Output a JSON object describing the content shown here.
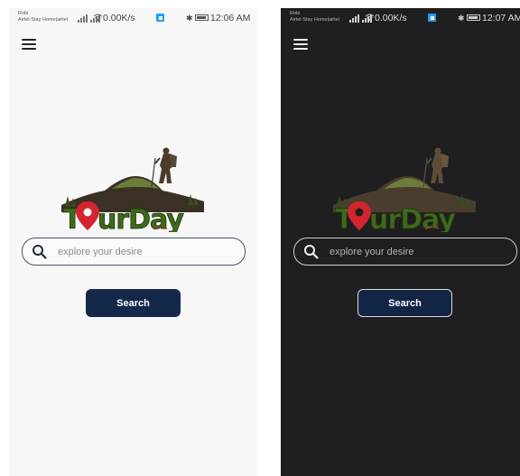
{
  "screens": {
    "light": {
      "status": {
        "carrier_top": "Robi",
        "carrier_bottom": "Airtel-Stay Home|airtel",
        "speed": "0.00K/s",
        "time": "12:06 AM"
      },
      "search_placeholder": "explore your desire",
      "search_button": "Search"
    },
    "dark": {
      "status": {
        "carrier_top": "Robi",
        "carrier_bottom": "Airtel-Stay Home|airtel",
        "speed": "0.00K/s",
        "time": "12:07 AM"
      },
      "search_placeholder": "explore your desire",
      "search_button": "Search"
    }
  },
  "logo_text": "TourDay",
  "icons": [
    "menu-icon",
    "search-icon",
    "wifi-icon",
    "bluetooth-icon",
    "battery-icon",
    "signal-icon",
    "location-pin-icon"
  ],
  "colors": {
    "button_navy": "#14294a",
    "logo_green": "#3f6a1a",
    "pin_red": "#d3252e",
    "dark_bg": "#1f1f21",
    "light_bg": "#f7f7f8"
  }
}
